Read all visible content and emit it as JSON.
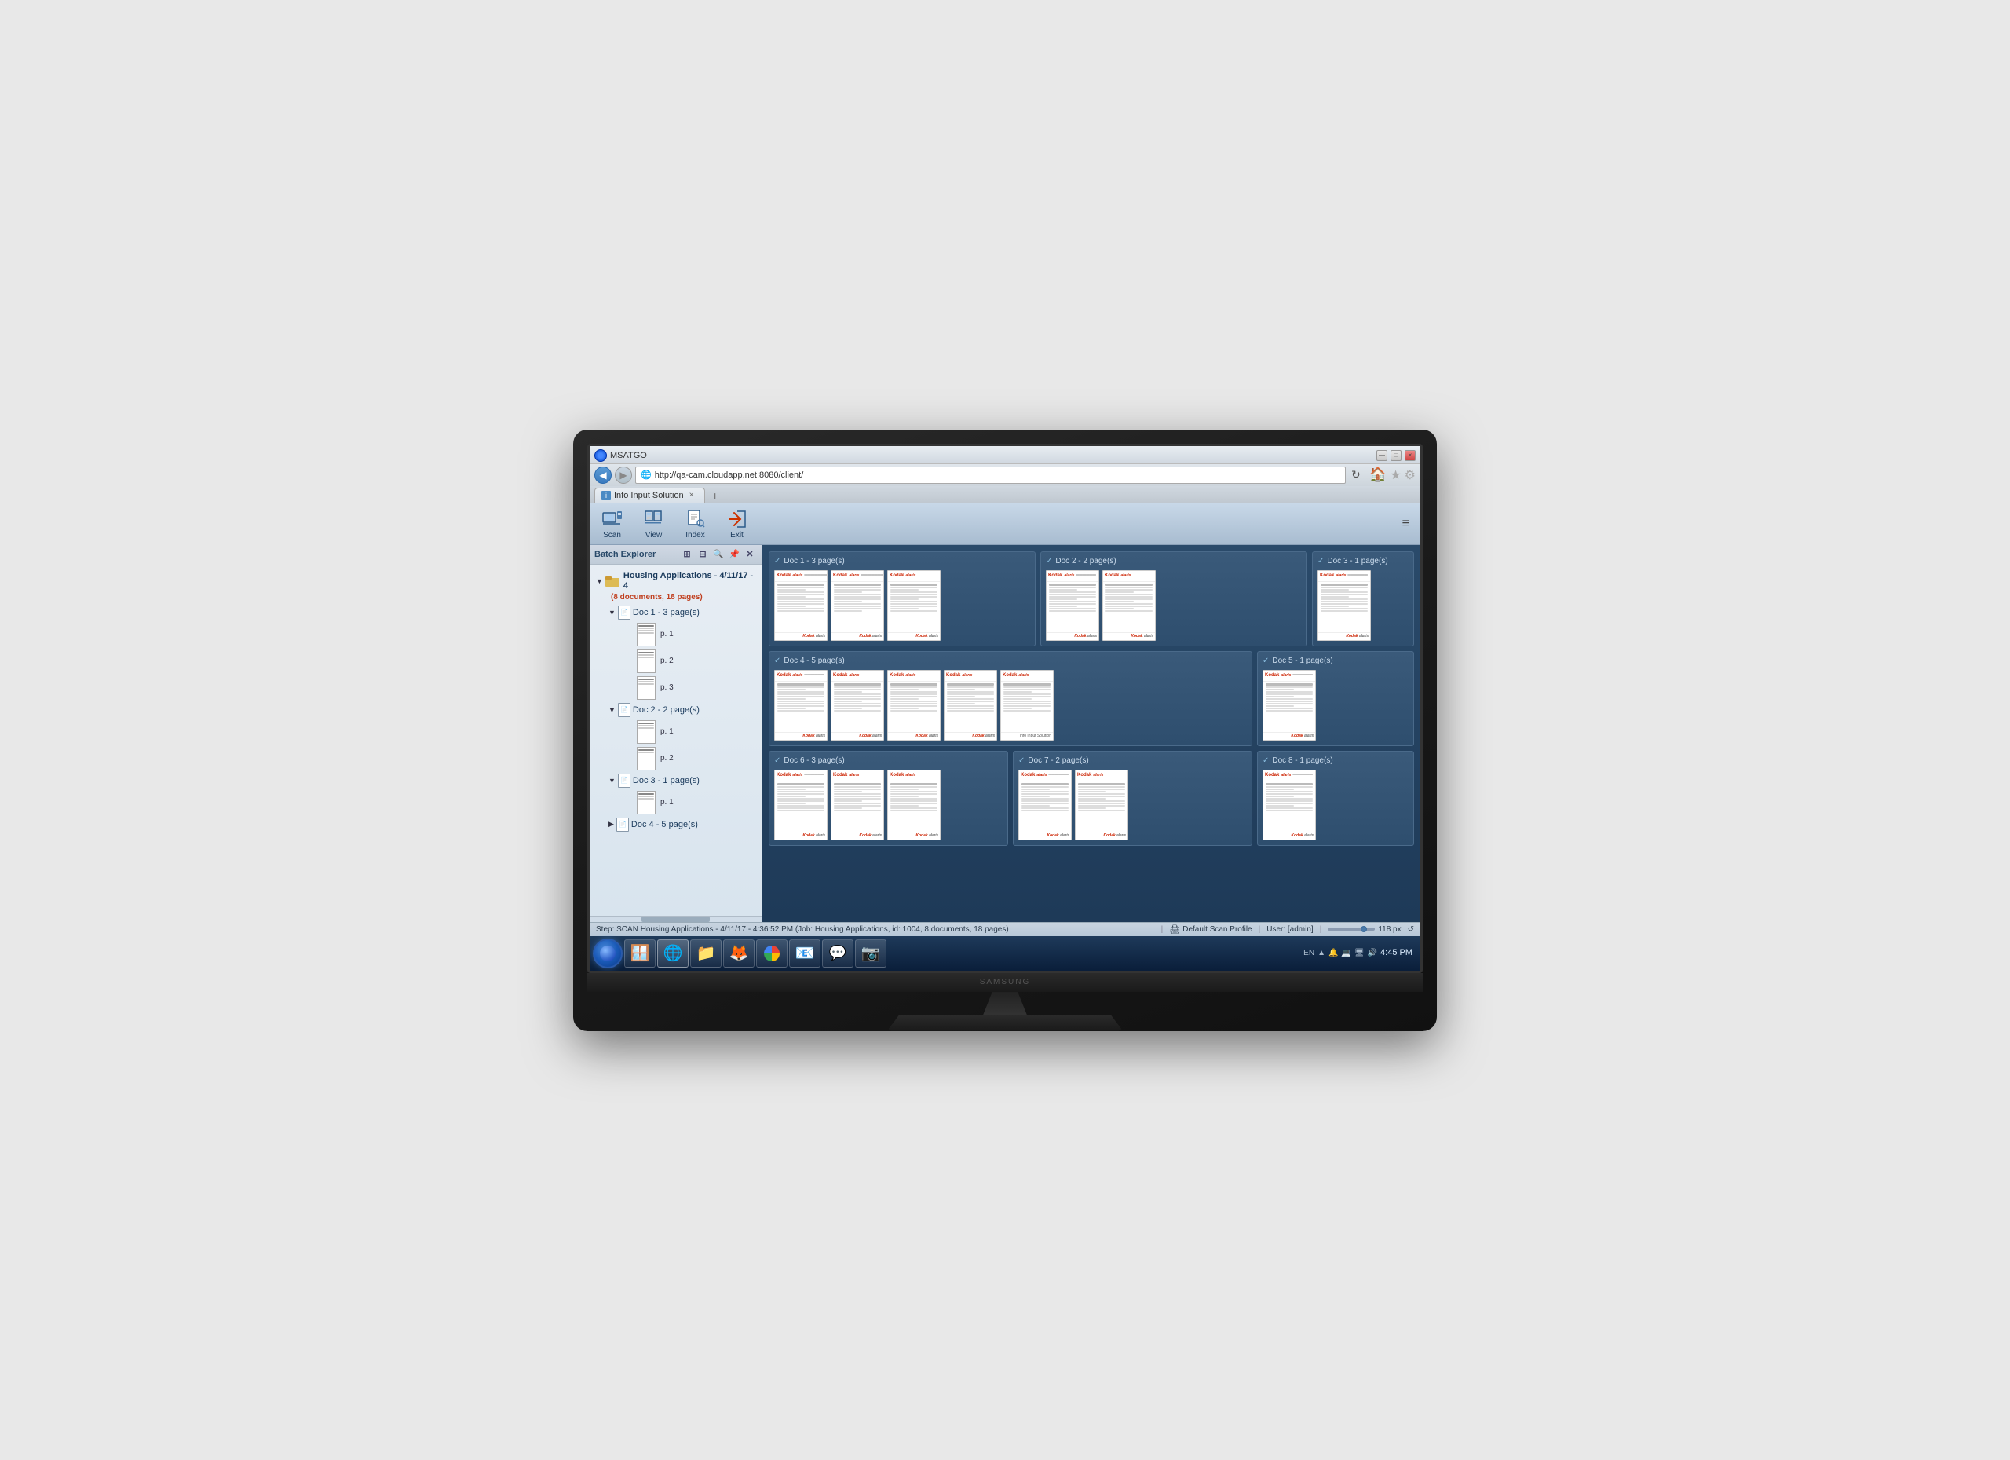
{
  "monitor": {
    "logo": "SAMSUNG"
  },
  "browser": {
    "address": "http://qa-cam.cloudapp.net:8080/client/",
    "tab_title": "Info Input Solution",
    "tab_close": "×",
    "nav": {
      "back_arrow": "◀",
      "forward_arrow": "▶",
      "refresh": "↻"
    },
    "window_controls": {
      "minimize": "—",
      "maximize": "□",
      "close": "×"
    },
    "favorites_icon": "★",
    "gear_icon": "⚙"
  },
  "toolbar": {
    "scan_label": "Scan",
    "view_label": "View",
    "index_label": "Index",
    "exit_label": "Exit",
    "menu_icon": "≡"
  },
  "sidebar": {
    "title": "Batch Explorer",
    "tools": {
      "expand_all": "+",
      "collapse_all": "−",
      "search": "🔍"
    },
    "batch": {
      "name": "Housing Applications - 4/11/17 - 4",
      "info": "(8 documents, 18 pages)",
      "docs": [
        {
          "name": "Doc 1 - 3 page(s)",
          "pages": [
            "p. 1",
            "p. 2",
            "p. 3"
          ]
        },
        {
          "name": "Doc 2 - 2 page(s)",
          "pages": [
            "p. 1",
            "p. 2"
          ]
        },
        {
          "name": "Doc 3 - 1 page(s)",
          "pages": [
            "p. 1"
          ]
        },
        {
          "name": "Doc 4 - 5 page(s)",
          "pages": []
        }
      ]
    }
  },
  "grid": {
    "docs": [
      {
        "id": 1,
        "title": "Doc 1 - 3 page(s)",
        "page_count": 3
      },
      {
        "id": 2,
        "title": "Doc 2 - 2 page(s)",
        "page_count": 2
      },
      {
        "id": 3,
        "title": "Doc 3 - 1 page(s)",
        "page_count": 1
      },
      {
        "id": 4,
        "title": "Doc 4 - 5 page(s)",
        "page_count": 5
      },
      {
        "id": 5,
        "title": "Doc 5 - 1 page(s)",
        "page_count": 1
      },
      {
        "id": 6,
        "title": "Doc 6 - 3 page(s)",
        "page_count": 3
      },
      {
        "id": 7,
        "title": "Doc 7 - 2 page(s)",
        "page_count": 2
      },
      {
        "id": 8,
        "title": "Doc 8 - 1 page(s)",
        "page_count": 1
      }
    ]
  },
  "status_bar": {
    "text": "Step: SCAN  Housing Applications - 4/11/17 - 4:36:52 PM (Job: Housing Applications, id: 1004, 8 documents, 18 pages)",
    "scan_profile": "Default Scan Profile",
    "user": "User: [admin]",
    "zoom": "118 px",
    "refresh_icon": "↺"
  },
  "taskbar": {
    "apps": [
      {
        "name": "windows-explorer",
        "icon": "📁"
      },
      {
        "name": "internet-explorer",
        "icon": "🌐"
      },
      {
        "name": "file-explorer",
        "icon": "📂"
      },
      {
        "name": "firefox",
        "icon": "🦊"
      },
      {
        "name": "chrome",
        "icon": "🔵"
      },
      {
        "name": "outlook",
        "icon": "📧"
      },
      {
        "name": "skype",
        "icon": "💬"
      },
      {
        "name": "camera",
        "icon": "📷"
      }
    ],
    "tray": {
      "language": "EN",
      "time": "4:45 PM"
    }
  }
}
